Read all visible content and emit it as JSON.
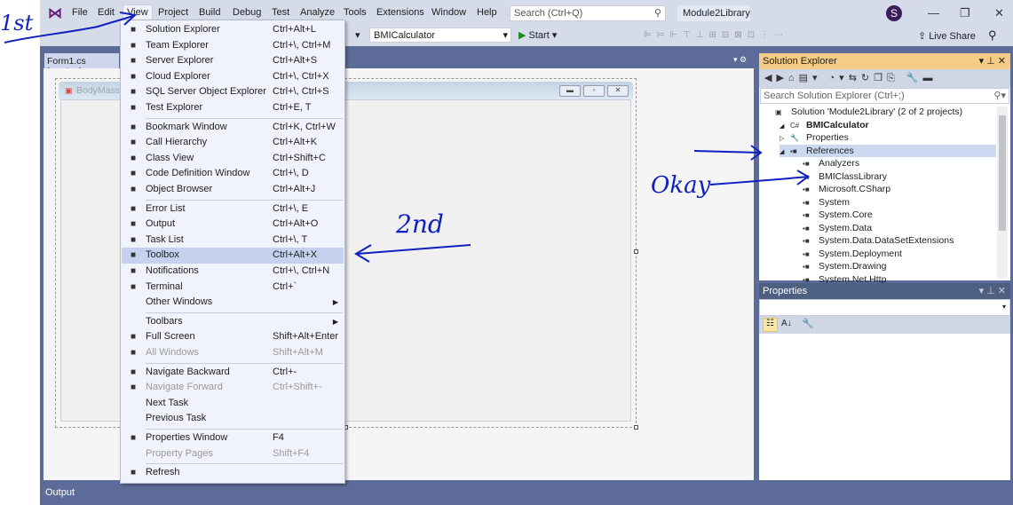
{
  "menubar": {
    "items": [
      "File",
      "Edit",
      "View",
      "Project",
      "Build",
      "Debug",
      "Test",
      "Analyze",
      "Tools",
      "Extensions",
      "Window",
      "Help"
    ],
    "search_placeholder": "Search (Ctrl+Q)",
    "project_name": "Module2Library",
    "avatar": "S"
  },
  "toolbar": {
    "startup_project": "BMICalculator",
    "start_label": "Start",
    "live_share": "Live Share"
  },
  "document": {
    "tab": "Form1.cs [Design]",
    "form_title": "BodyMassIn"
  },
  "view_menu": {
    "items": [
      {
        "icon": "solution-explorer-icon",
        "label": "Solution Explorer",
        "shortcut": "Ctrl+Alt+L"
      },
      {
        "icon": "team-explorer-icon",
        "label": "Team Explorer",
        "shortcut": "Ctrl+\\, Ctrl+M"
      },
      {
        "icon": "server-icon",
        "label": "Server Explorer",
        "shortcut": "Ctrl+Alt+S"
      },
      {
        "icon": "cloud-icon",
        "label": "Cloud Explorer",
        "shortcut": "Ctrl+\\, Ctrl+X"
      },
      {
        "icon": "sql-server-icon",
        "label": "SQL Server Object Explorer",
        "shortcut": "Ctrl+\\, Ctrl+S"
      },
      {
        "icon": "test-explorer-icon",
        "label": "Test Explorer",
        "shortcut": "Ctrl+E, T"
      },
      {
        "sep": true
      },
      {
        "icon": "bookmark-icon",
        "label": "Bookmark Window",
        "shortcut": "Ctrl+K, Ctrl+W"
      },
      {
        "icon": "call-hierarchy-icon",
        "label": "Call Hierarchy",
        "shortcut": "Ctrl+Alt+K"
      },
      {
        "icon": "class-view-icon",
        "label": "Class View",
        "shortcut": "Ctrl+Shift+C"
      },
      {
        "icon": "code-definition-icon",
        "label": "Code Definition Window",
        "shortcut": "Ctrl+\\, D"
      },
      {
        "icon": "object-browser-icon",
        "label": "Object Browser",
        "shortcut": "Ctrl+Alt+J"
      },
      {
        "sep": true
      },
      {
        "icon": "error-list-icon",
        "label": "Error List",
        "shortcut": "Ctrl+\\, E"
      },
      {
        "icon": "output-icon",
        "label": "Output",
        "shortcut": "Ctrl+Alt+O"
      },
      {
        "icon": "task-list-icon",
        "label": "Task List",
        "shortcut": "Ctrl+\\, T"
      },
      {
        "icon": "toolbox-icon",
        "label": "Toolbox",
        "shortcut": "Ctrl+Alt+X",
        "highlighted": true
      },
      {
        "icon": "bell-icon",
        "label": "Notifications",
        "shortcut": "Ctrl+\\, Ctrl+N"
      },
      {
        "icon": "terminal-icon",
        "label": "Terminal",
        "shortcut": "Ctrl+`"
      },
      {
        "label": "Other Windows",
        "submenu": true
      },
      {
        "sep": true
      },
      {
        "label": "Toolbars",
        "submenu": true
      },
      {
        "icon": "full-screen-icon",
        "label": "Full Screen",
        "shortcut": "Shift+Alt+Enter"
      },
      {
        "icon": "all-windows-icon",
        "label": "All Windows",
        "shortcut": "Shift+Alt+M",
        "disabled": true
      },
      {
        "sep": true
      },
      {
        "icon": "navigate-backward-icon",
        "label": "Navigate Backward",
        "shortcut": "Ctrl+-"
      },
      {
        "icon": "navigate-forward-icon",
        "label": "Navigate Forward",
        "shortcut": "Ctrl+Shift+-",
        "disabled": true
      },
      {
        "label": "Next Task"
      },
      {
        "label": "Previous Task"
      },
      {
        "sep": true
      },
      {
        "icon": "wrench-icon",
        "label": "Properties Window",
        "shortcut": "F4"
      },
      {
        "label": "Property Pages",
        "shortcut": "Shift+F4",
        "disabled": true
      },
      {
        "sep": true
      },
      {
        "icon": "refresh-icon",
        "label": "Refresh"
      }
    ]
  },
  "solution_explorer": {
    "title": "Solution Explorer",
    "search_placeholder": "Search Solution Explorer (Ctrl+;)",
    "tree": [
      {
        "label": "Solution 'Module2Library' (2 of 2 projects)",
        "level": 0
      },
      {
        "label": "BMICalculator",
        "level": 1,
        "bold": true,
        "expanded": true
      },
      {
        "label": "Properties",
        "level": 2,
        "collapsed": true
      },
      {
        "label": "References",
        "level": 2,
        "expanded": true,
        "selected": true
      },
      {
        "label": "Analyzers",
        "level": 3
      },
      {
        "label": "BMIClassLibrary",
        "level": 3
      },
      {
        "label": "Microsoft.CSharp",
        "level": 3
      },
      {
        "label": "System",
        "level": 3
      },
      {
        "label": "System.Core",
        "level": 3
      },
      {
        "label": "System.Data",
        "level": 3
      },
      {
        "label": "System.Data.DataSetExtensions",
        "level": 3
      },
      {
        "label": "System.Deployment",
        "level": 3
      },
      {
        "label": "System.Drawing",
        "level": 3
      },
      {
        "label": "System.Net.Http",
        "level": 3
      }
    ]
  },
  "properties": {
    "title": "Properties"
  },
  "output": {
    "title": "Output"
  },
  "annotations": {
    "first": "1st",
    "second": "2nd",
    "okay": "Okay"
  },
  "colors": {
    "ink": "#1020c0",
    "menu_highlight": "#c5d1ee",
    "active_header": "#f5cc84",
    "ide_frame": "#5d6b99"
  }
}
